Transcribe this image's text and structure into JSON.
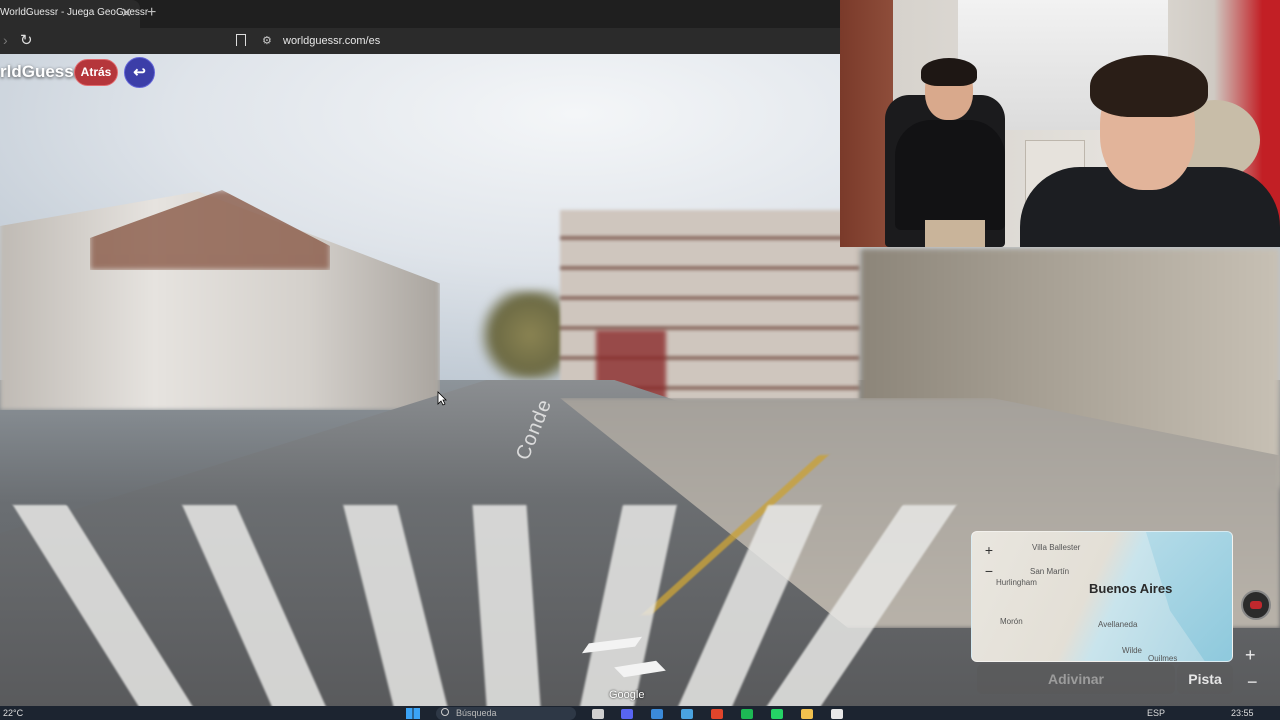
{
  "browser": {
    "tab_title": "WorldGuessr - Juega GeoGuessr",
    "tab_close": "✕",
    "new_tab": "+",
    "url": "worldguessr.com/es"
  },
  "game": {
    "logo_text": "rldGuessr",
    "back_button": "Atrás",
    "return_icon": "↩",
    "street_name": "Conde",
    "google_mark": "Google"
  },
  "minimap": {
    "zoom_in": "+",
    "zoom_out": "−",
    "city": "Buenos Aires",
    "labels": [
      "Villa Ballester",
      "San Martín",
      "Hurlingham",
      "Morón",
      "Avellaneda",
      "Wilde",
      "Quilmes"
    ]
  },
  "controls": {
    "guess_button": "Adivinar",
    "hint_button": "Pista",
    "zoom_plus": "+",
    "zoom_minus": "−"
  },
  "taskbar": {
    "weather": "22°C",
    "search_placeholder": "Búsqueda",
    "language": "ESP",
    "clock": "23:55"
  },
  "colors": {
    "back_button_bg": "#b5363b",
    "return_button_bg": "#3c3ea8"
  }
}
